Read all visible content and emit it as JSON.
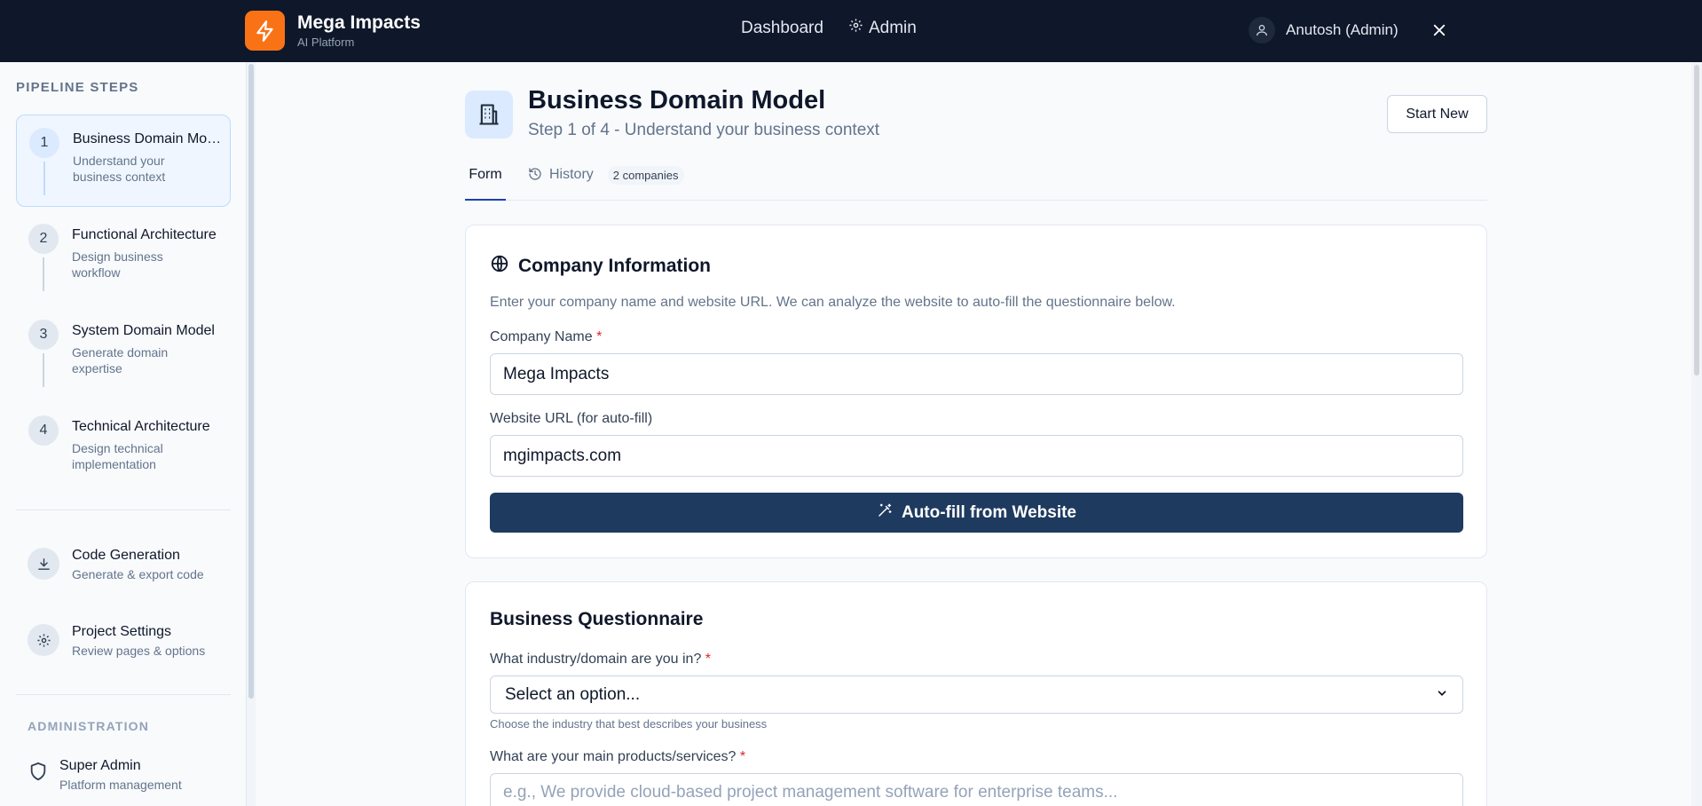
{
  "brand": {
    "name": "Mega Impacts",
    "subtitle": "AI Platform",
    "logo_icon": "lightning-icon",
    "accent": "#f97316"
  },
  "topnav": {
    "dashboard": "Dashboard",
    "admin": "Admin"
  },
  "user": {
    "name": "Anutosh (Admin)"
  },
  "sidebar": {
    "section_title": "PIPELINE STEPS",
    "steps": [
      {
        "num": "1",
        "title": "Business Domain Model",
        "desc": "Understand your business context"
      },
      {
        "num": "2",
        "title": "Functional Architecture",
        "desc": "Design business workflow"
      },
      {
        "num": "3",
        "title": "System Domain Model",
        "desc": "Generate domain expertise"
      },
      {
        "num": "4",
        "title": "Technical Architecture",
        "desc": "Design technical implementation"
      }
    ],
    "tools": [
      {
        "title": "Code Generation",
        "desc": "Generate & export code",
        "icon": "download-icon"
      },
      {
        "title": "Project Settings",
        "desc": "Review pages & options",
        "icon": "gear-icon"
      }
    ],
    "admin_title": "ADMINISTRATION",
    "admin_item": {
      "title": "Super Admin",
      "desc": "Platform management",
      "icon": "shield-icon"
    }
  },
  "page": {
    "title": "Business Domain Model",
    "subtitle": "Step 1 of 4 - Understand your business context",
    "start_new": "Start New"
  },
  "tabs": {
    "form": "Form",
    "history": "History",
    "history_badge": "2 companies"
  },
  "company_card": {
    "title": "Company Information",
    "desc": "Enter your company name and website URL. We can analyze the website to auto-fill the questionnaire below.",
    "name_label": "Company Name",
    "name_value": "Mega Impacts",
    "url_label": "Website URL (for auto-fill)",
    "url_value": "mgimpacts.com",
    "autofill_button": "Auto-fill from Website",
    "required_mark": "*"
  },
  "questionnaire": {
    "title": "Business Questionnaire",
    "industry_label": "What industry/domain are you in?",
    "industry_selected": "Select an option...",
    "industry_hint": "Choose the industry that best describes your business",
    "products_label": "What are your main products/services?",
    "products_placeholder": "e.g., We provide cloud-based project management software for enterprise teams..."
  },
  "colors": {
    "topbar": "#0f172a",
    "primary_button": "#1e3a5f",
    "active_step_bg": "#eff6ff",
    "required": "#dc2626"
  }
}
